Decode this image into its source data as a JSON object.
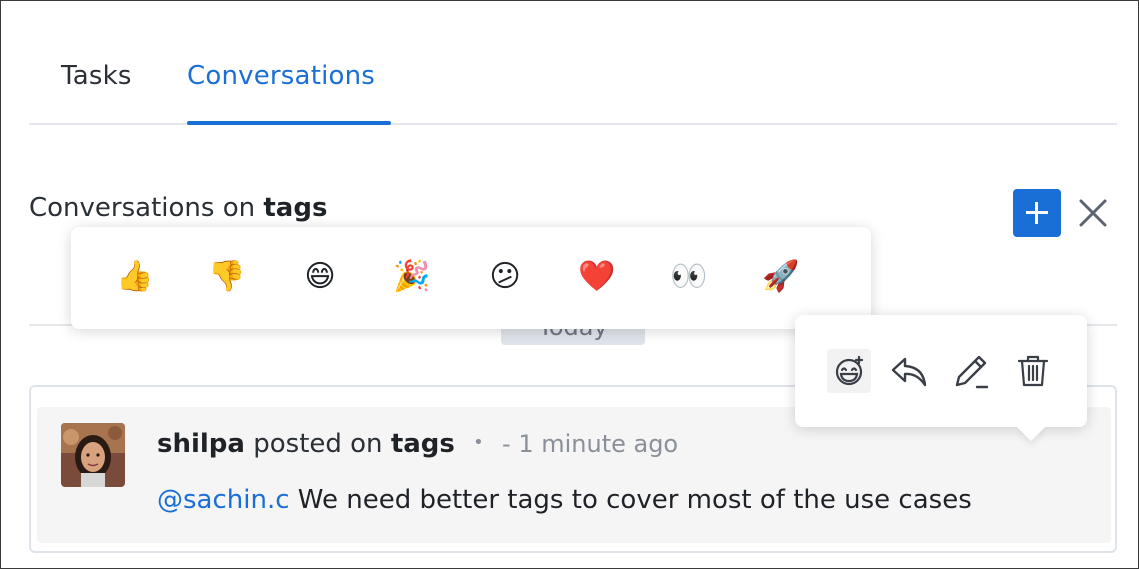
{
  "tabs": [
    {
      "label": "Tasks",
      "active": false
    },
    {
      "label": "Conversations",
      "active": true
    }
  ],
  "header": {
    "title_prefix": "Conversations on",
    "title_subject": "tags"
  },
  "day_separator": "Today",
  "message": {
    "author": "shilpa",
    "action": "posted on",
    "subject": "tags",
    "separator": "•",
    "time": "- 1 minute ago",
    "mention": "@sachin.c",
    "text": " We need better tags to cover most of the use cases"
  },
  "reactions": [
    {
      "name": "thumbs-up",
      "glyph": "👍"
    },
    {
      "name": "thumbs-down",
      "glyph": "👎"
    },
    {
      "name": "grinning",
      "glyph": "😄"
    },
    {
      "name": "party-popper",
      "glyph": "🎉"
    },
    {
      "name": "confused",
      "glyph": "😕"
    },
    {
      "name": "heart",
      "glyph": "❤️"
    },
    {
      "name": "eyes",
      "glyph": "👀"
    },
    {
      "name": "rocket",
      "glyph": "🚀"
    }
  ],
  "actions": [
    "add-reaction-icon",
    "reply-icon",
    "edit-icon",
    "delete-icon"
  ],
  "colors": {
    "accent": "#1a6fd6",
    "muted_text": "#8a9099",
    "card_bg": "#f5f5f5"
  }
}
